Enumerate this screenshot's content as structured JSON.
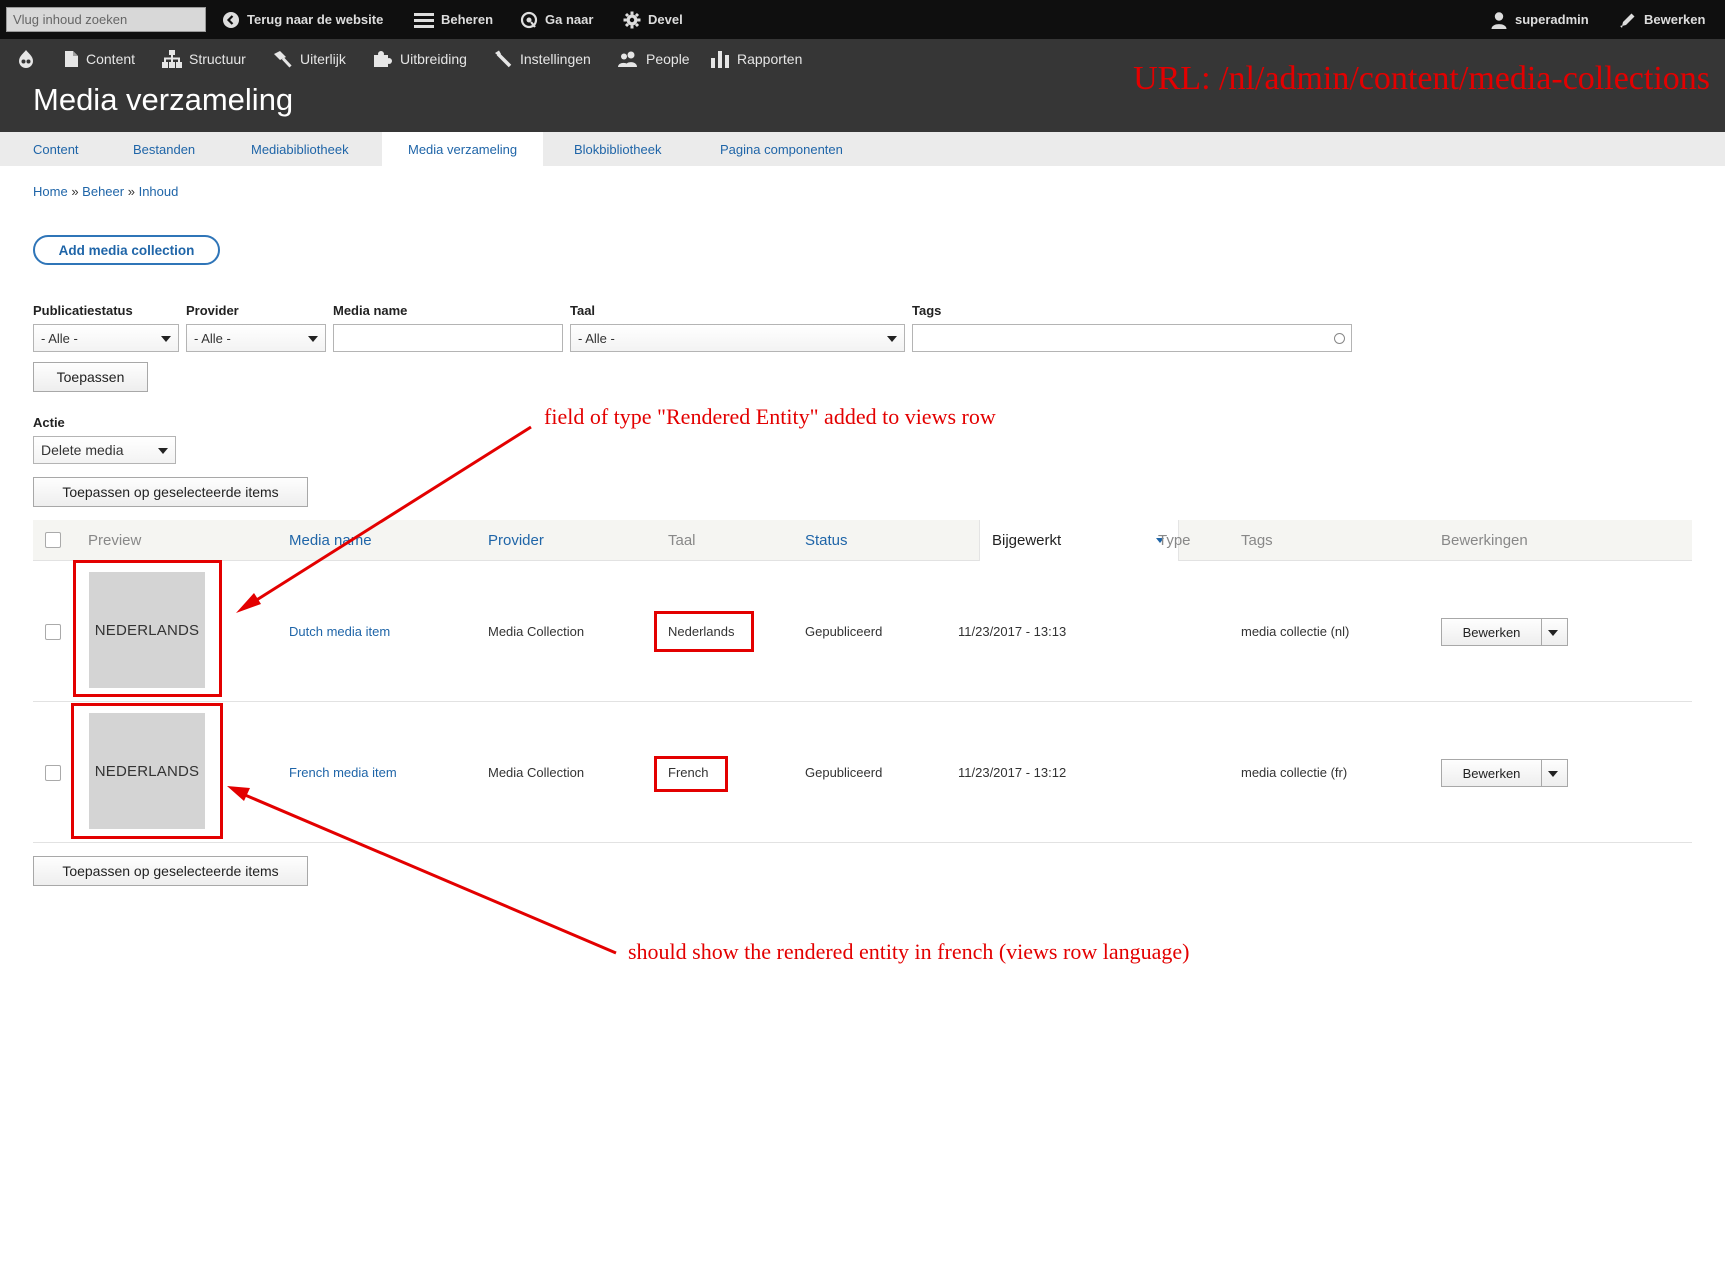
{
  "toolbar": {
    "search_placeholder": "Vlug inhoud zoeken",
    "back_label": "Terug naar de website",
    "manage_label": "Beheren",
    "goto_label": "Ga naar",
    "devel_label": "Devel",
    "user_label": "superadmin",
    "edit_label": "Bewerken"
  },
  "tray": {
    "items": [
      "Content",
      "Structuur",
      "Uiterlijk",
      "Uitbreiding",
      "Instellingen",
      "People",
      "Rapporten"
    ]
  },
  "page": {
    "title": "Media verzameling",
    "url_note": "URL: /nl/admin/content/media-collections"
  },
  "tabs": [
    "Content",
    "Bestanden",
    "Mediabibliotheek",
    "Media verzameling",
    "Blokbibliotheek",
    "Pagina componenten"
  ],
  "active_tab": "Media verzameling",
  "breadcrumb": {
    "home": "Home",
    "sep": "»",
    "beheer": "Beheer",
    "inhoud": "Inhoud"
  },
  "add_button": "Add media collection",
  "filters": {
    "status_label": "Publicatiestatus",
    "status_value": "- Alle -",
    "provider_label": "Provider",
    "provider_value": "- Alle -",
    "name_label": "Media name",
    "name_value": "",
    "language_label": "Taal",
    "language_value": "- Alle -",
    "tags_label": "Tags",
    "tags_value": "",
    "apply_button": "Toepassen"
  },
  "bulk": {
    "action_label": "Actie",
    "action_value": "Delete media",
    "apply_button": "Toepassen op geselecteerde items"
  },
  "table": {
    "headers": {
      "preview": "Preview",
      "name": "Media name",
      "provider": "Provider",
      "language": "Taal",
      "status": "Status",
      "updated": "Bijgewerkt",
      "type": "Type",
      "tags": "Tags",
      "operations": "Bewerkingen"
    },
    "rows": [
      {
        "preview_text": "NEDERLANDS",
        "name": "Dutch media item",
        "provider": "Media Collection",
        "language": "Nederlands",
        "status": "Gepubliceerd",
        "updated": "11/23/2017 - 13:13",
        "type": "",
        "tags": "media collectie (nl)",
        "operation": "Bewerken"
      },
      {
        "preview_text": "NEDERLANDS",
        "name": "French media item",
        "provider": "Media Collection",
        "language": "French",
        "status": "Gepubliceerd",
        "updated": "11/23/2017 - 13:12",
        "type": "",
        "tags": "media collectie (fr)",
        "operation": "Bewerken"
      }
    ]
  },
  "annotations": {
    "top": "field of type \"Rendered Entity\" added to views row",
    "bottom": "should show the rendered entity in french (views row language)",
    "color": "#e30000"
  },
  "colors": {
    "link": "#1f65a8",
    "toolbar_bg": "#0f0f0f",
    "tray_bg": "#363636",
    "tabs_bg": "#ebebeb"
  }
}
